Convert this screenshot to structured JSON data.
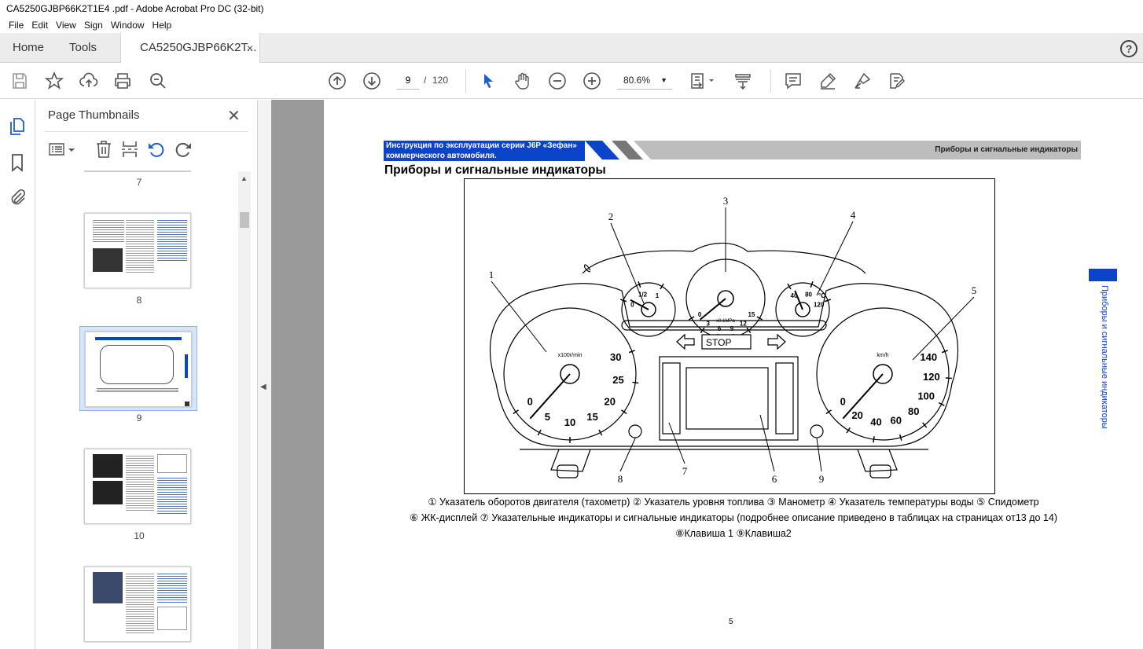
{
  "window": {
    "title": "CA5250GJBP66K2T1E4 .pdf - Adobe Acrobat Pro DC (32-bit)"
  },
  "menu": [
    "File",
    "Edit",
    "View",
    "Sign",
    "Window",
    "Help"
  ],
  "tabs": {
    "home": "Home",
    "tools": "Tools",
    "document": "CA5250GJBP66K2T...",
    "close": "×"
  },
  "help": "?",
  "toolbar": {
    "page_current": "9",
    "page_sep": "/",
    "page_total": "120",
    "zoom": "80.6%",
    "zoom_arrow": "▼"
  },
  "panel": {
    "title": "Page Thumbnails",
    "close": "✕",
    "thumbs": [
      {
        "label": "7"
      },
      {
        "label": "8"
      },
      {
        "label": "9"
      },
      {
        "label": "10"
      }
    ]
  },
  "document": {
    "header_left": "Инструкция по эксплуатации серии J6P «Зефан» коммерческого автомобиля.",
    "header_right": "Приборы и сигнальные индикаторы",
    "title": "Приборы и сигнальные индикаторы",
    "legend_line1": "① Указатель оборотов двигателя (тахометр) ② Указатель уровня топлива ③ Манометр ④ Указатель температуры воды ⑤ Спидометр",
    "legend_line2": "⑥ ЖК-дисплей ⑦ Указательные индикаторы и сигнальные индикаторы (подробнее описание приведено в таблицах на страницах от13 до 14)",
    "legend_line3": "⑧Клавиша 1 ⑨Клавиша2",
    "page_number": "5",
    "side_text": "Приборы и сигнальные индикаторы"
  },
  "figure": {
    "callouts": [
      "1",
      "2",
      "3",
      "4",
      "5",
      "6",
      "7",
      "8",
      "9"
    ],
    "tach_ticks": [
      "0",
      "5",
      "10",
      "15",
      "20",
      "25",
      "30"
    ],
    "tach_unit": "x100r/min",
    "speed_ticks": [
      "0",
      "20",
      "40",
      "60",
      "80",
      "100",
      "120",
      "140"
    ],
    "speed_unit": "km/h",
    "fuel_ticks": [
      "0",
      "1/2",
      "1"
    ],
    "press_ticks": [
      "0",
      "3",
      "6",
      "9",
      "12",
      "15"
    ],
    "press_unit": "x0.1MPa",
    "temp_ticks": [
      "40",
      "80",
      "120"
    ],
    "temp_unit": "°C",
    "stop_label": "STOP"
  },
  "colors": {
    "accent": "#0b44c9",
    "toolbar_icon": "#555555",
    "viewer_bg": "#9a9a9a"
  }
}
